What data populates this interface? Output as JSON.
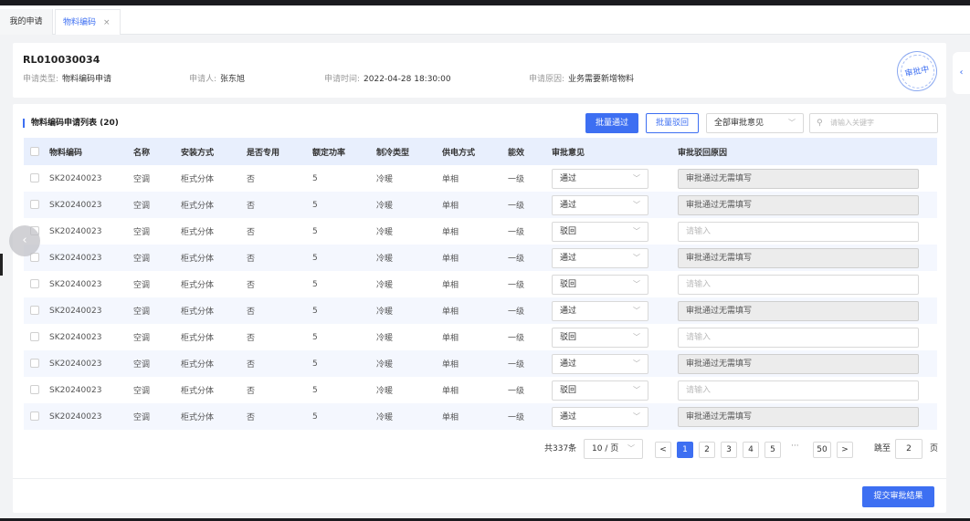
{
  "tabs": {
    "home": "我的申请",
    "active": "物料编码",
    "close": "×"
  },
  "header": {
    "code": "RL010030034",
    "type_label": "申请类型:",
    "type_value": "物料编码申请",
    "applicant_label": "申请人:",
    "applicant_value": "张东旭",
    "time_label": "申请时间:",
    "time_value": "2022-04-28 18:30:00",
    "reason_label": "申请原因:",
    "reason_value": "业务需要新增物料",
    "stamp": "审批中"
  },
  "side_handle": "‹",
  "list": {
    "title": "物料编码申请列表 (20)",
    "batch_pass": "批量通过",
    "batch_reject": "批量驳回",
    "filter_value": "全部审批意见",
    "search_placeholder": "请输入关键字"
  },
  "columns": [
    "物料编码",
    "名称",
    "安装方式",
    "是否专用",
    "额定功率",
    "制冷类型",
    "供电方式",
    "能效",
    "审批意见",
    "审批驳回原因"
  ],
  "rows": [
    {
      "code": "SK20240023",
      "name": "空调",
      "install": "柜式分体",
      "special": "否",
      "power": "5",
      "cool": "冷暖",
      "supply": "单相",
      "eff": "一级",
      "opinion": "通过",
      "reason": "审批通过无需填写",
      "disabled": true
    },
    {
      "code": "SK20240023",
      "name": "空调",
      "install": "柜式分体",
      "special": "否",
      "power": "5",
      "cool": "冷暖",
      "supply": "单相",
      "eff": "一级",
      "opinion": "通过",
      "reason": "审批通过无需填写",
      "disabled": true
    },
    {
      "code": "SK20240023",
      "name": "空调",
      "install": "柜式分体",
      "special": "否",
      "power": "5",
      "cool": "冷暖",
      "supply": "单相",
      "eff": "一级",
      "opinion": "驳回",
      "reason": "请输入",
      "disabled": false
    },
    {
      "code": "SK20240023",
      "name": "空调",
      "install": "柜式分体",
      "special": "否",
      "power": "5",
      "cool": "冷暖",
      "supply": "单相",
      "eff": "一级",
      "opinion": "通过",
      "reason": "审批通过无需填写",
      "disabled": true
    },
    {
      "code": "SK20240023",
      "name": "空调",
      "install": "柜式分体",
      "special": "否",
      "power": "5",
      "cool": "冷暖",
      "supply": "单相",
      "eff": "一级",
      "opinion": "驳回",
      "reason": "请输入",
      "disabled": false
    },
    {
      "code": "SK20240023",
      "name": "空调",
      "install": "柜式分体",
      "special": "否",
      "power": "5",
      "cool": "冷暖",
      "supply": "单相",
      "eff": "一级",
      "opinion": "通过",
      "reason": "审批通过无需填写",
      "disabled": true
    },
    {
      "code": "SK20240023",
      "name": "空调",
      "install": "柜式分体",
      "special": "否",
      "power": "5",
      "cool": "冷暖",
      "supply": "单相",
      "eff": "一级",
      "opinion": "驳回",
      "reason": "请输入",
      "disabled": false
    },
    {
      "code": "SK20240023",
      "name": "空调",
      "install": "柜式分体",
      "special": "否",
      "power": "5",
      "cool": "冷暖",
      "supply": "单相",
      "eff": "一级",
      "opinion": "通过",
      "reason": "审批通过无需填写",
      "disabled": true
    },
    {
      "code": "SK20240023",
      "name": "空调",
      "install": "柜式分体",
      "special": "否",
      "power": "5",
      "cool": "冷暖",
      "supply": "单相",
      "eff": "一级",
      "opinion": "驳回",
      "reason": "请输入",
      "disabled": false
    },
    {
      "code": "SK20240023",
      "name": "空调",
      "install": "柜式分体",
      "special": "否",
      "power": "5",
      "cool": "冷暖",
      "supply": "单相",
      "eff": "一级",
      "opinion": "通过",
      "reason": "审批通过无需填写",
      "disabled": true
    }
  ],
  "pagination": {
    "total": "共337条",
    "page_size": "10 / 页",
    "prev": "<",
    "next": ">",
    "pages": [
      "1",
      "2",
      "3",
      "4",
      "5"
    ],
    "ellipsis": "···",
    "last": "50",
    "current": "1",
    "jump_label": "跳至",
    "jump_value": "2",
    "jump_unit": "页"
  },
  "submit_label": "提交审批结果",
  "colors": {
    "accent": "#3d6ff2"
  }
}
